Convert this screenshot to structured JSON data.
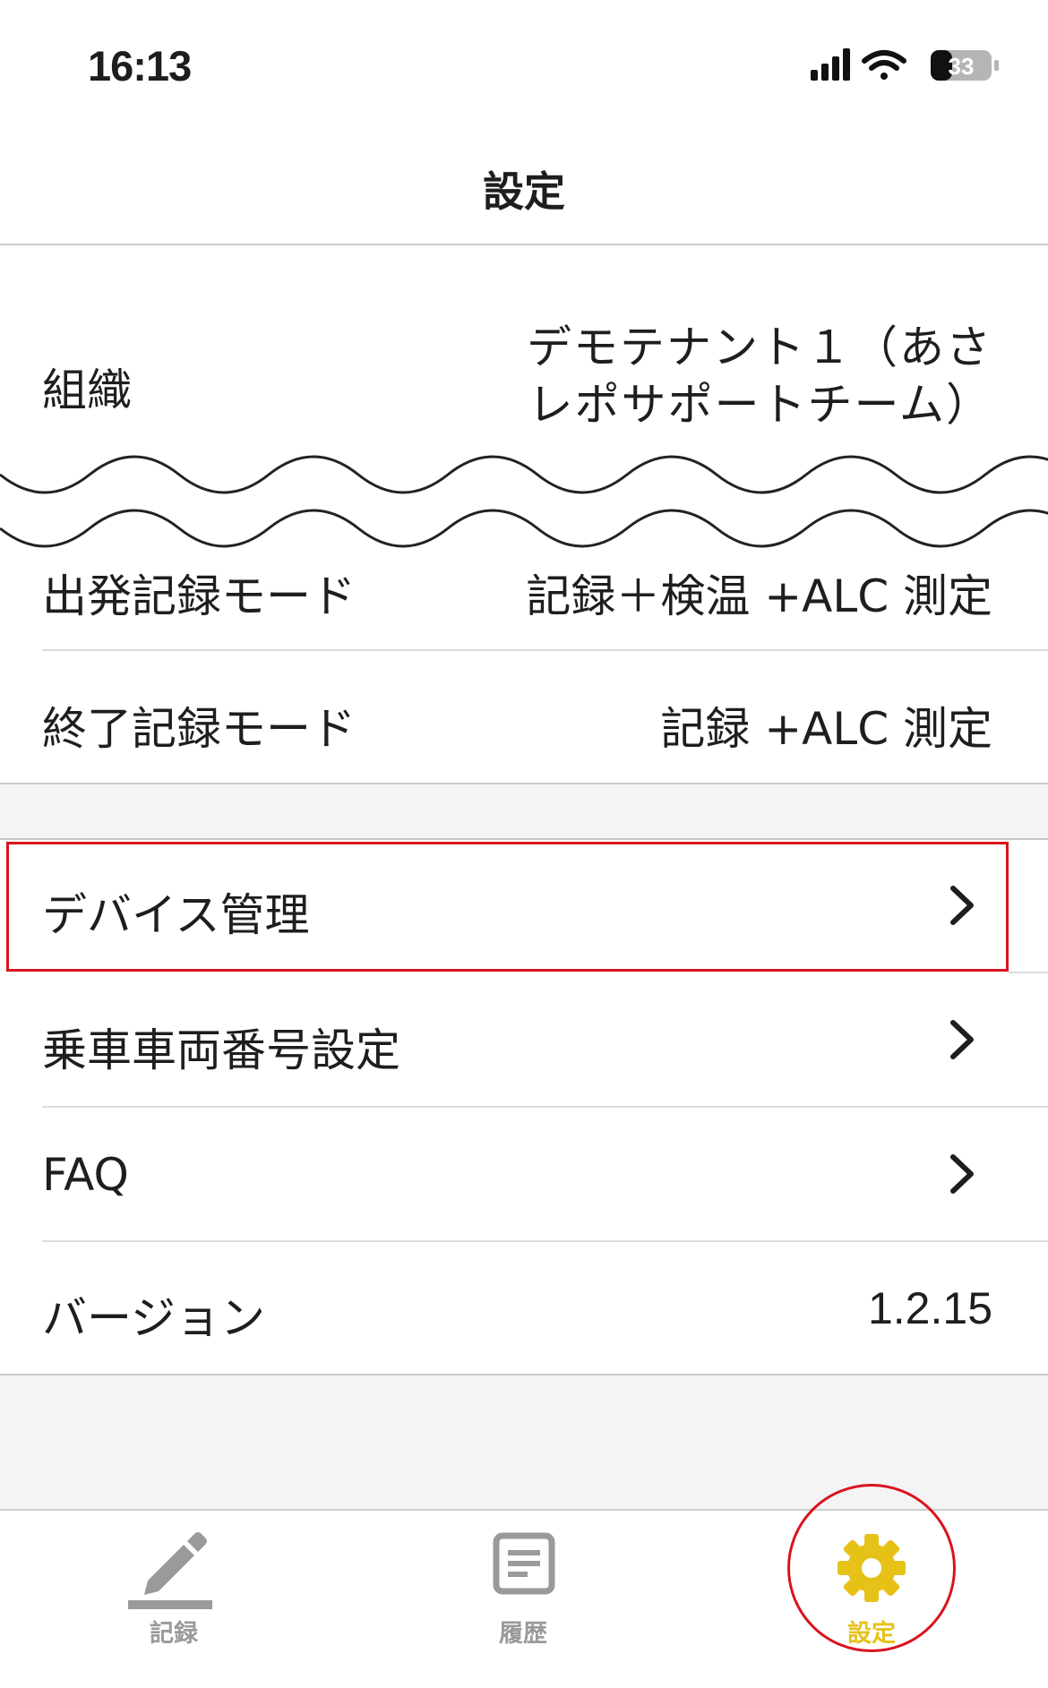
{
  "status_bar": {
    "time": "16:13",
    "battery": "33"
  },
  "header": {
    "title": "設定"
  },
  "settings_top": {
    "organization": {
      "label": "組織",
      "value_line1": "デモテナント１（あさ",
      "value_line2": "レポサポートチーム）"
    },
    "departure_mode": {
      "label": "出発記録モード",
      "value": "記録＋検温 +ALC 測定"
    },
    "end_mode": {
      "label": "終了記録モード",
      "value": "記録 +ALC 測定"
    }
  },
  "menu": [
    {
      "label": "デバイス管理"
    },
    {
      "label": "乗車車両番号設定"
    },
    {
      "label": "FAQ"
    }
  ],
  "version": {
    "label": "バージョン",
    "value": "1.2.15"
  },
  "tabbar": {
    "items": [
      {
        "label": "記録",
        "icon": "pencil-icon"
      },
      {
        "label": "履歴",
        "icon": "document-icon"
      },
      {
        "label": "設定",
        "icon": "gear-icon",
        "active": true
      }
    ]
  },
  "colors": {
    "accent": "#e6c219",
    "inactive": "#9a9a9a",
    "highlight": "#d9141d"
  }
}
